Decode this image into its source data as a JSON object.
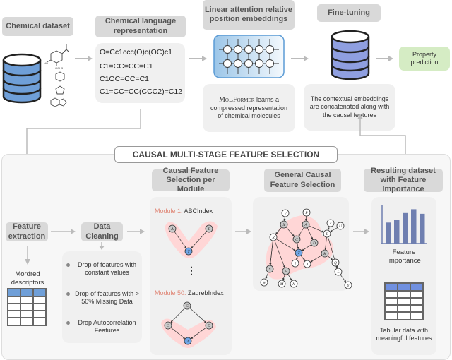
{
  "top": {
    "chemical_dataset": {
      "header": "Chemical dataset",
      "icon": "database-icon"
    },
    "chemical_language": {
      "header": "Chemical language representation",
      "smiles": [
        "O=Cc1ccc(O)c(OC)c1",
        "C1=CC=CC=C1",
        "C1OC=CC=C1",
        "C1=CC=CC(CCC2)=C12"
      ]
    },
    "linear_attention": {
      "header": "Linear attention relative position embeddings",
      "desc_name": "MoLFormer",
      "desc_rest": " learns a compressed representation of chemical molecules"
    },
    "fine_tuning": {
      "header": "Fine-tuning",
      "desc": "The contextual embeddings are concatenated along with the causal features"
    },
    "property_prediction": {
      "label": "Property prediction",
      "color": "#d5ecc4"
    }
  },
  "panel": {
    "title": "CAUSAL MULTI-STAGE FEATURE SELECTION",
    "feature_extraction": {
      "header": "Feature extraction",
      "label": "Mordred descriptors"
    },
    "data_cleaning": {
      "header": "Data Cleaning",
      "bullets": [
        "Drop of features with constant values",
        "Drop of features with > 50% Missing Data",
        "Drop Autocorrelation Features"
      ]
    },
    "per_module": {
      "header": "Causal Feature Selection per Module",
      "module1_key": "Module 1:",
      "module1_name": "ABCIndex",
      "ellipsis": "⋮",
      "module50_key": "Module 50:",
      "module50_name": "ZagrebIndex",
      "module1_nodes": [
        "A",
        "B",
        "T"
      ],
      "module50_nodes": [
        "G",
        "C",
        "D",
        "T"
      ]
    },
    "general": {
      "header": "General Causal Feature Selection",
      "nodes": [
        "V",
        "P",
        "X",
        "A",
        "Z",
        "U",
        "E",
        "R",
        "C",
        "D",
        "T",
        "K",
        "I",
        "J",
        "Q",
        "L",
        "S",
        "H",
        "W",
        "M",
        "N",
        "Y"
      ]
    },
    "result": {
      "header": "Resulting dataset with Feature Importance",
      "chart_label": "Feature Importance",
      "table_label": "Tabular data with meaningful features",
      "importance_values": [
        0.55,
        0.62,
        0.8,
        0.9,
        0.78
      ]
    }
  },
  "colors": {
    "db_blue": "#6f9fd8",
    "db_purple": "#8f9fe0",
    "node_blue": "#6fa6e6",
    "highlight": "#ffd6d6",
    "bar": "#6f7fb0",
    "accent_red": "#e08878"
  }
}
